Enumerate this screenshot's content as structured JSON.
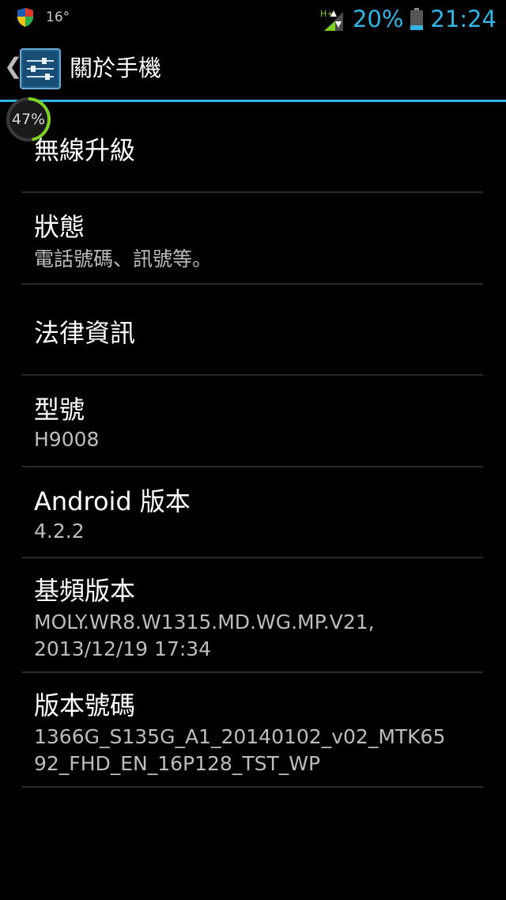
{
  "status_bar": {
    "temperature": "16°",
    "network_type": "H+",
    "battery_percent": "20%",
    "time": "21:24",
    "accent_color": "#33b5e5"
  },
  "action_bar": {
    "back_glyph": "❮",
    "title": "關於手機",
    "icon": "settings-sliders-icon"
  },
  "progress": {
    "label": "47%",
    "value": 0.47
  },
  "items": [
    {
      "title": "無線升級",
      "subtitle": ""
    },
    {
      "title": "狀態",
      "subtitle": "電話號碼、訊號等。"
    },
    {
      "title": "法律資訊",
      "subtitle": ""
    },
    {
      "title": "型號",
      "subtitle": "H9008"
    },
    {
      "title": "Android 版本",
      "subtitle": "4.2.2"
    },
    {
      "title": "基頻版本",
      "subtitle": "MOLY.WR8.W1315.MD.WG.MP.V21,\n2013/12/19 17:34"
    },
    {
      "title": "版本號碼",
      "subtitle": "1366G_S135G_A1_20140102_v02_MTK65\n92_FHD_EN_16P128_TST_WP"
    }
  ]
}
